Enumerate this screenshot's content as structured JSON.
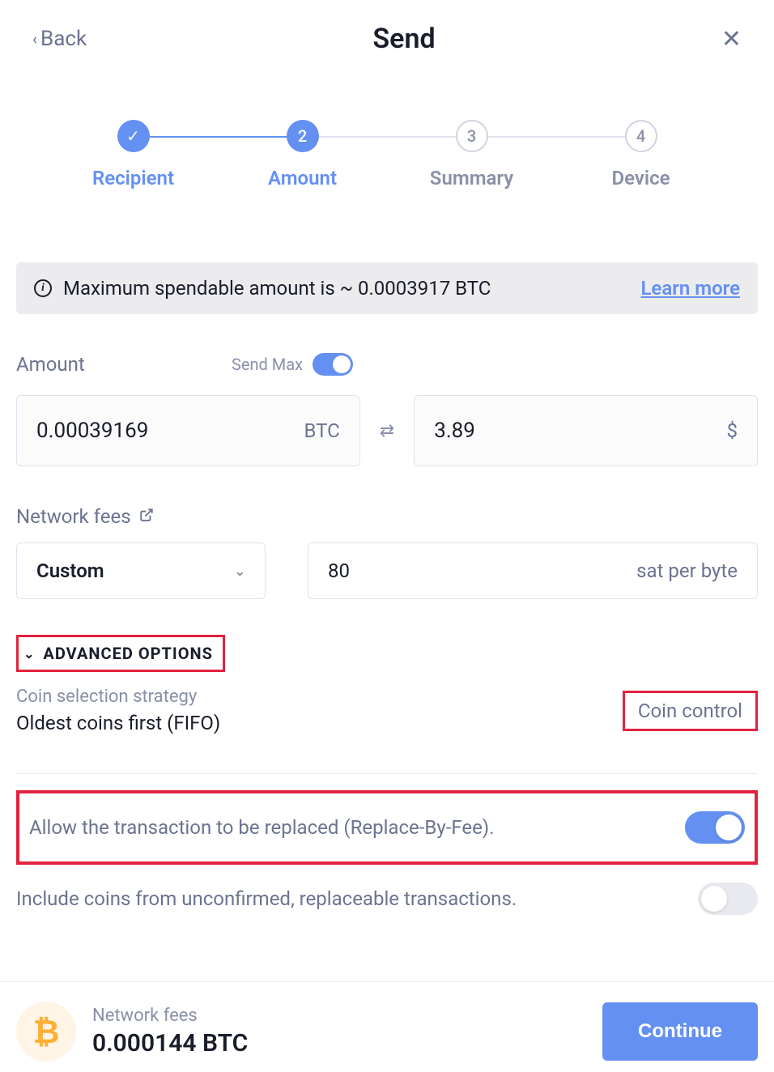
{
  "header": {
    "back_label": "Back",
    "title": "Send"
  },
  "steps": [
    {
      "label": "Recipient",
      "indicator": "✓",
      "active": true
    },
    {
      "label": "Amount",
      "indicator": "2",
      "active": true
    },
    {
      "label": "Summary",
      "indicator": "3",
      "active": false
    },
    {
      "label": "Device",
      "indicator": "4",
      "active": false
    }
  ],
  "info_banner": {
    "text": "Maximum spendable amount is ~ 0.0003917 BTC",
    "link": "Learn more"
  },
  "amount": {
    "label": "Amount",
    "send_max_label": "Send Max",
    "crypto_value": "0.00039169",
    "crypto_unit": "BTC",
    "fiat_value": "3.89",
    "fiat_unit": "$"
  },
  "fees": {
    "label": "Network fees",
    "select_value": "Custom",
    "fee_value": "80",
    "fee_unit": "sat per byte"
  },
  "advanced": {
    "toggle_label": "ADVANCED OPTIONS",
    "coin_strategy_label": "Coin selection strategy",
    "coin_strategy_value": "Oldest coins first (FIFO)",
    "coin_control_btn": "Coin control",
    "rbf_label": "Allow the transaction to be replaced (Replace-By-Fee).",
    "unconfirmed_label": "Include coins from unconfirmed, replaceable transactions."
  },
  "footer": {
    "fees_label": "Network fees",
    "fees_value": "0.000144 BTC",
    "continue_label": "Continue",
    "btc_symbol": "₿"
  }
}
